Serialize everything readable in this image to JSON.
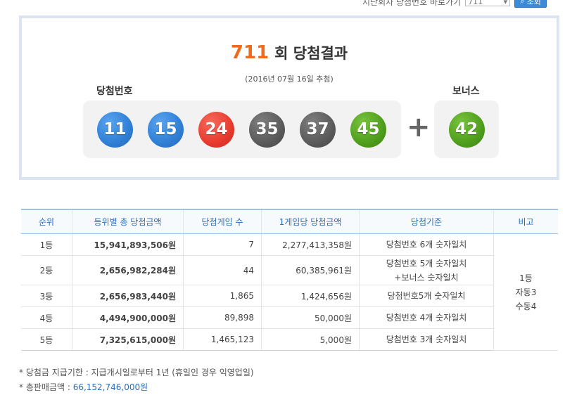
{
  "search": {
    "label": "지난회차 당첨번호 바로가기",
    "selected": "711",
    "button": "조회"
  },
  "draw": {
    "round": "711",
    "round_suffix": "회 당첨결과",
    "date": "(2016년 07월 16일 추첨)",
    "main_label": "당첨번호",
    "bonus_label": "보너스",
    "numbers": [
      "11",
      "15",
      "24",
      "35",
      "37",
      "45"
    ],
    "bonus": "42",
    "plus": "+",
    "colors": {
      "blue": "#2f7fd6",
      "red": "#e83a2e",
      "gray": "#5b5b5b",
      "green": "#4f9e1c",
      "accent": "#ee6a1c"
    }
  },
  "table": {
    "headers": [
      "순위",
      "등위별 총 당첨금액",
      "당첨게임 수",
      "1게임당 당첨금액",
      "당첨기준",
      "비고"
    ],
    "rows": [
      {
        "rank": "1등",
        "total": "15,941,893,506원",
        "count": "7",
        "per": "2,277,413,358원",
        "crit1": "당첨번호 6개 숫자일치",
        "crit2": ""
      },
      {
        "rank": "2등",
        "total": "2,656,982,284원",
        "count": "44",
        "per": "60,385,961원",
        "crit1": "당첨번호 5개 숫자일치",
        "crit2": "+보너스 숫자일치"
      },
      {
        "rank": "3등",
        "total": "2,656,983,440원",
        "count": "1,865",
        "per": "1,424,656원",
        "crit1": "당첨번호5개 숫자일치",
        "crit2": ""
      },
      {
        "rank": "4등",
        "total": "4,494,900,000원",
        "count": "89,898",
        "per": "50,000원",
        "crit1": "당첨번호 4개 숫자일치",
        "crit2": ""
      },
      {
        "rank": "5등",
        "total": "7,325,615,000원",
        "count": "1,465,123",
        "per": "5,000원",
        "crit1": "당첨번호 3개 숫자일치",
        "crit2": ""
      }
    ],
    "note": [
      "1등",
      "자동3",
      "수동4"
    ]
  },
  "notes": {
    "line1": "* 당첨금 지급기한 : 지급개시일로부터 1년 (휴일인 경우 익영업일)",
    "line2_label": "* 총판매금액 : ",
    "line2_value": "66,152,746,000원"
  }
}
